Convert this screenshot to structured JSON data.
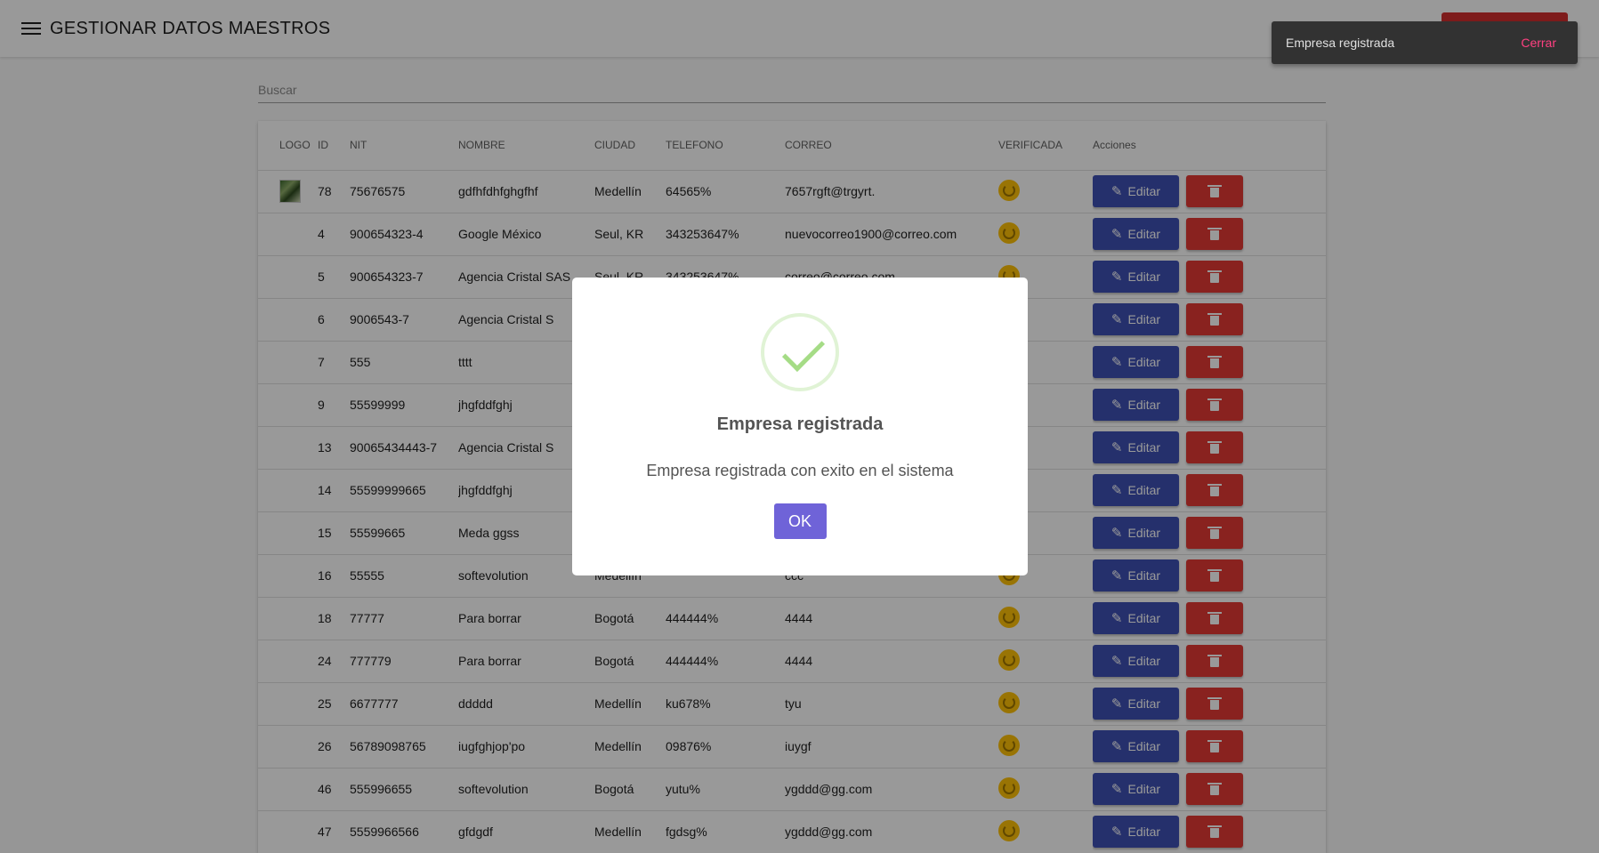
{
  "header": {
    "title": "GESTIONAR DATOS MAESTROS"
  },
  "search": {
    "placeholder": "Buscar"
  },
  "table": {
    "headers": {
      "logo": "LOGO",
      "id": "ID",
      "nit": "NIT",
      "nombre": "NOMBRE",
      "ciudad": "CIUDAD",
      "telefono": "TELEFONO",
      "correo": "CORREO",
      "verificada": "VERIFICADA",
      "acciones": "Acciones"
    },
    "edit_label": "Editar",
    "rows": [
      {
        "has_logo": true,
        "id": "78",
        "nit": "75676575",
        "nombre": "gdfhfdhfghgfhf",
        "ciudad": "Medellín",
        "telefono": "64565%",
        "correo": "7657rgft@trgyrt."
      },
      {
        "has_logo": false,
        "id": "4",
        "nit": "900654323-4",
        "nombre": "Google México",
        "ciudad": "Seul, KR",
        "telefono": "343253647%",
        "correo": "nuevocorreo1900@correo.com"
      },
      {
        "has_logo": false,
        "id": "5",
        "nit": "900654323-7",
        "nombre": "Agencia Cristal SAS",
        "ciudad": "Seul, KR",
        "telefono": "343253647%",
        "correo": "correo@correo.com"
      },
      {
        "has_logo": false,
        "id": "6",
        "nit": "9006543-7",
        "nombre": "Agencia Cristal S",
        "ciudad": "",
        "telefono": "",
        "correo": ""
      },
      {
        "has_logo": false,
        "id": "7",
        "nit": "555",
        "nombre": "tttt",
        "ciudad": "",
        "telefono": "",
        "correo": ""
      },
      {
        "has_logo": false,
        "id": "9",
        "nit": "55599999",
        "nombre": "jhgfddfghj",
        "ciudad": "",
        "telefono": "",
        "correo": ""
      },
      {
        "has_logo": false,
        "id": "13",
        "nit": "90065434443-7",
        "nombre": "Agencia Cristal S",
        "ciudad": "",
        "telefono": "",
        "correo": ""
      },
      {
        "has_logo": false,
        "id": "14",
        "nit": "55599999665",
        "nombre": "jhgfddfghj",
        "ciudad": "",
        "telefono": "",
        "correo": ""
      },
      {
        "has_logo": false,
        "id": "15",
        "nit": "55599665",
        "nombre": "Meda ggss",
        "ciudad": "",
        "telefono": "",
        "correo": ""
      },
      {
        "has_logo": false,
        "id": "16",
        "nit": "55555",
        "nombre": "softevolution",
        "ciudad": "Medellín",
        "telefono": "",
        "correo": "ccc"
      },
      {
        "has_logo": false,
        "id": "18",
        "nit": "77777",
        "nombre": "Para borrar",
        "ciudad": "Bogotá",
        "telefono": "444444%",
        "correo": "4444"
      },
      {
        "has_logo": false,
        "id": "24",
        "nit": "777779",
        "nombre": "Para borrar",
        "ciudad": "Bogotá",
        "telefono": "444444%",
        "correo": "4444"
      },
      {
        "has_logo": false,
        "id": "25",
        "nit": "6677777",
        "nombre": "ddddd",
        "ciudad": "Medellín",
        "telefono": "ku678%",
        "correo": "tyu"
      },
      {
        "has_logo": false,
        "id": "26",
        "nit": "56789098765",
        "nombre": "iugfghjop'po",
        "ciudad": "Medellín",
        "telefono": "09876%",
        "correo": "iuygf"
      },
      {
        "has_logo": false,
        "id": "46",
        "nit": "555996655",
        "nombre": "softevolution",
        "ciudad": "Bogotá",
        "telefono": "yutu%",
        "correo": "ygddd@gg.com"
      },
      {
        "has_logo": false,
        "id": "47",
        "nit": "5559966566",
        "nombre": "gfdgdf",
        "ciudad": "Medellín",
        "telefono": "fgdsg%",
        "correo": "ygddd@gg.com"
      }
    ]
  },
  "snackbar": {
    "message": "Empresa registrada",
    "action": "Cerrar"
  },
  "dialog": {
    "icon": "success-check-icon",
    "title": "Empresa registrada",
    "text": "Empresa registrada con exito en el sistema",
    "ok_label": "OK"
  },
  "colors": {
    "primary": "#3f51b5",
    "danger": "#e53935",
    "verify": "#ffc107",
    "ok_button": "#6f63d8",
    "success": "#a5dc86",
    "snackbar_action": "#ff4081"
  }
}
